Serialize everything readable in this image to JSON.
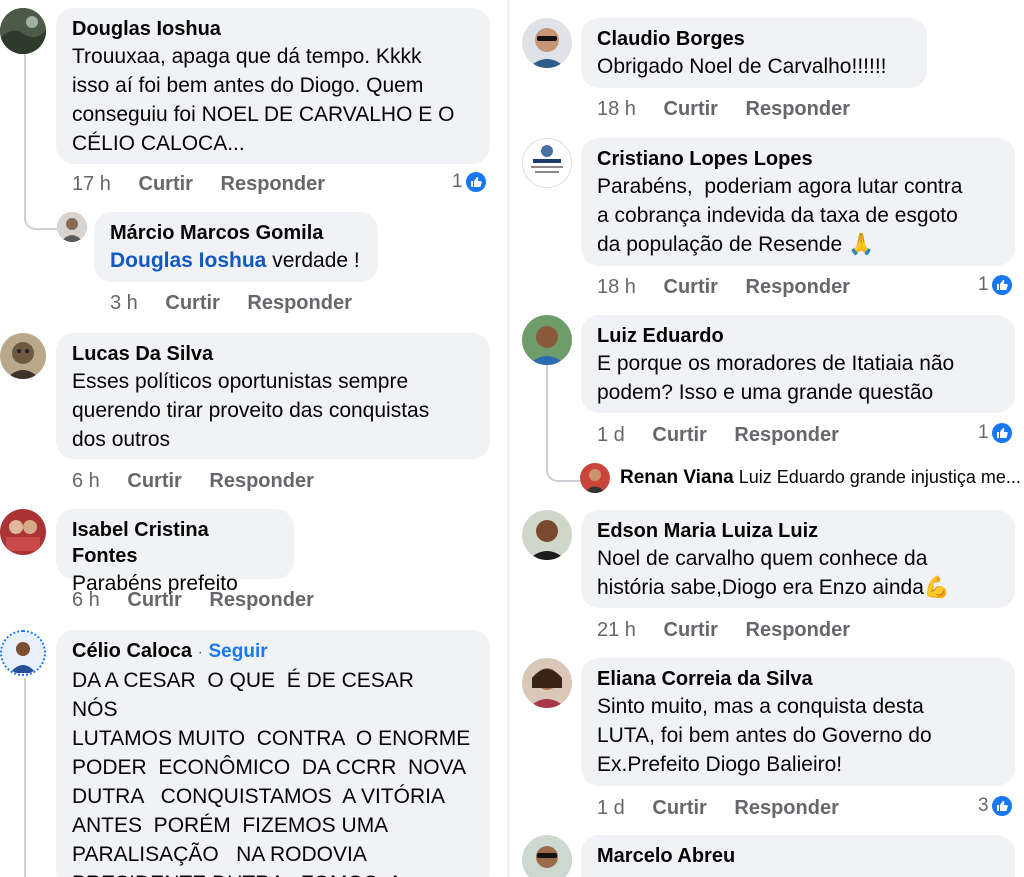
{
  "colors": {
    "bubble": "#f0f2f5",
    "meta": "#65676b",
    "mention": "#1158c7",
    "follow": "#1877f2",
    "like": "#1877f2"
  },
  "left": {
    "c1": {
      "author": "Douglas Ioshua",
      "text": "Trouuxaa, apaga que dá tempo. Kkkk\nisso aí foi bem antes do Diogo. Quem\nconseguiu foi NOEL DE CARVALHO E O\nCÉLIO CALOCA...",
      "time": "17 h",
      "like": "Curtir",
      "reply": "Responder",
      "reactions": "1"
    },
    "c1r": {
      "author": "Márcio Marcos Gomila",
      "mention": "Douglas Ioshua",
      "text": " verdade !",
      "time": "3 h",
      "like": "Curtir",
      "reply": "Responder"
    },
    "c2": {
      "author": "Lucas Da Silva",
      "text": "Esses políticos oportunistas sempre\nquerendo tirar proveito das conquistas\ndos outros",
      "time": "6 h",
      "like": "Curtir",
      "reply": "Responder"
    },
    "c3": {
      "author": "Isabel Cristina Fontes",
      "text": "Parabéns prefeito",
      "time": "6 h",
      "like": "Curtir",
      "reply": "Responder"
    },
    "c4": {
      "author": "Célio Caloca",
      "separator": "·",
      "follow": "Seguir",
      "text": "DA A CESAR  O QUE  É DE CESAR   NÓS\nLUTAMOS MUITO  CONTRA  O ENORME\nPODER  ECONÔMICO  DA CCRR  NOVA\nDUTRA   CONQUISTAMOS  A VITÓRIA\nANTES  PORÉM  FIZEMOS UMA\nPARALISAÇÃO   NA RODOVIA\nPRESIDENTE DUTRA   FOMOS  A"
    }
  },
  "right": {
    "c1": {
      "author": "Claudio Borges",
      "text": "Obrigado Noel de Carvalho!!!!!!",
      "time": "18 h",
      "like": "Curtir",
      "reply": "Responder"
    },
    "c2": {
      "author": "Cristiano Lopes Lopes",
      "text": "Parabéns,  poderiam agora lutar contra\na cobrança indevida da taxa de esgoto\nda população de Resende 🙏",
      "time": "18 h",
      "like": "Curtir",
      "reply": "Responder",
      "reactions": "1"
    },
    "c3": {
      "author": "Luiz Eduardo",
      "text": "E porque os moradores de Itatiaia não\npodem? Isso e uma grande questão",
      "time": "1 d",
      "like": "Curtir",
      "reply": "Responder",
      "reactions": "1"
    },
    "c3r": {
      "author": "Renan Viana",
      "text": "Luiz Eduardo grande injustiça me..."
    },
    "c4": {
      "author": "Edson Maria Luiza Luiz",
      "text": "Noel de carvalho quem conhece da\nhistória sabe,Diogo era Enzo ainda💪",
      "time": "21 h",
      "like": "Curtir",
      "reply": "Responder"
    },
    "c5": {
      "author": "Eliana Correia da Silva",
      "text": "Sinto muito, mas a conquista desta\nLUTA, foi bem antes do Governo do\nEx.Prefeito Diogo Balieiro!",
      "time": "1 d",
      "like": "Curtir",
      "reply": "Responder",
      "reactions": "3"
    },
    "c6": {
      "author": "Marcelo Abreu"
    }
  }
}
